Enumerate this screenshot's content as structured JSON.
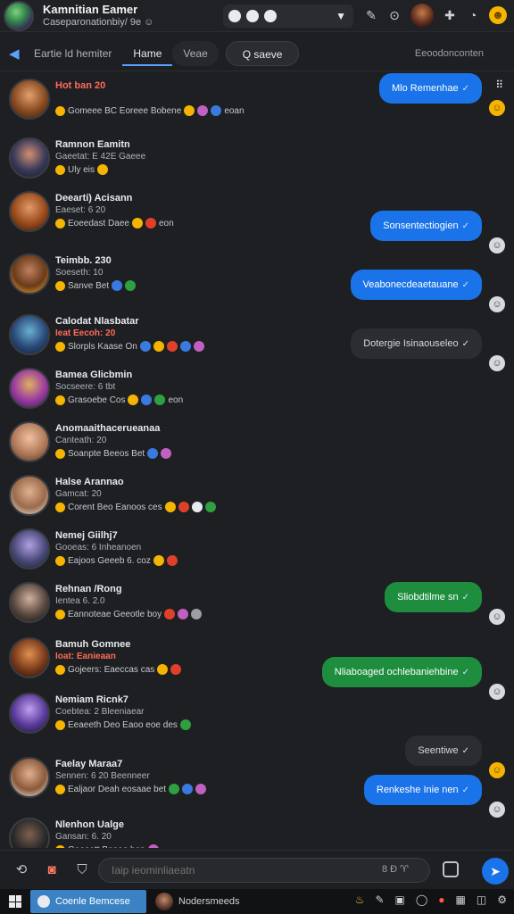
{
  "window": {
    "title": "Kamnitian Eamer",
    "subtitle": "Caseparonationbiy/ 9e ☺"
  },
  "tabs": {
    "back_label": "Eartie ld hemiter",
    "items": [
      {
        "label": "Hame",
        "active": true
      },
      {
        "label": "Veae",
        "active": false
      }
    ],
    "search_label": "Q saeve",
    "right_label": "Eeoodonconten"
  },
  "conversations": [
    {
      "name": "Hot ban 20",
      "sub": "",
      "line": "Gomeee BC Eoreee Bobene",
      "tail": "eoan",
      "alert_name": true
    },
    {
      "name": "Ramnon Eamitn",
      "sub": "Gaeetat: E 42E Gaeee",
      "line": "Uly eis",
      "tail": ""
    },
    {
      "name": "Deearti) Acisann",
      "sub": "Eaeset: 6 20",
      "line": "Eoeedast Daee",
      "tail": "eon"
    },
    {
      "name": "Teimbb. 230",
      "sub": "Soeseth: 10",
      "line": "Sanve Bet",
      "tail": ""
    },
    {
      "name": "Calodat Nlasbatar",
      "sub": "Ieat Eecoh: 20",
      "line": "Slorpls Kaase On",
      "tail": "",
      "alert_sub": true
    },
    {
      "name": "Bamea Glicbmin",
      "sub": "Socseere: 6 tbt",
      "line": "Grasoebe Cos",
      "tail": "eon"
    },
    {
      "name": "Anomaaithacerueanaa",
      "sub": "Canteath: 20",
      "line": "Soanpte Beeos Bet",
      "tail": ""
    },
    {
      "name": "Halse Arannao",
      "sub": "Gamcat: 20",
      "line": "Corent Beo Eanoos ces",
      "tail": ""
    },
    {
      "name": "Nemej Giilhj7",
      "sub": "Gooeas: 6 Inheanoen",
      "line": "Eajoos Geeeb 6. coz",
      "tail": ""
    },
    {
      "name": "Rehnan /Rong",
      "sub": "Ientea 6. 2.0",
      "line": "Eannoteae Geeotle boy",
      "tail": ""
    },
    {
      "name": "Bamuh Gomnee",
      "sub": "Ioat: Eanieaan",
      "line": "Gojeers: Eaeccas cas",
      "tail": "",
      "alert_sub": true
    },
    {
      "name": "Nemiam Ricnk7",
      "sub": "Coebtea: 2 Bleeniaear",
      "line": "Eeaeeth Deo Eaoo eoe des",
      "tail": ""
    },
    {
      "name": "Faelay Maraa7",
      "sub": "Sennen: 6 20 Beenneer",
      "line": "Ealjaor Deah eosaae bet",
      "tail": ""
    },
    {
      "name": "Nlenhon Ualge",
      "sub": "Gansan: 6. 20",
      "line": "Gaeeatt Beaeo ban",
      "tail": ""
    }
  ],
  "bubbles": [
    {
      "text": "Mlo Remenhae",
      "color": "blue",
      "react": "yellow"
    },
    {
      "text": "Sonsentectiogien",
      "color": "blue",
      "react": "gray"
    },
    {
      "text": "Veabonecdeaetauane",
      "color": "blue",
      "react": "gray"
    },
    {
      "text": "Dotergie Isinaouseleo",
      "color": "dark",
      "react": "gray"
    },
    {
      "text": "Sliobdtilme sn",
      "color": "green",
      "react": "gray"
    },
    {
      "text": "Nliaboaged ochlebaniehbine",
      "color": "green",
      "react": "gray"
    },
    {
      "text": "Seentiwe",
      "color": "dark",
      "react": "yellow"
    },
    {
      "text": "Renkeshe Inie nen",
      "color": "blue",
      "react": "gray"
    }
  ],
  "composer": {
    "placeholder": "Iaip ieominliaeatn",
    "inline_icons": "8 Ð  ♈"
  },
  "taskbar": {
    "active_app": "Coenle Bemcese",
    "second_app": "Nodersmeeds"
  }
}
